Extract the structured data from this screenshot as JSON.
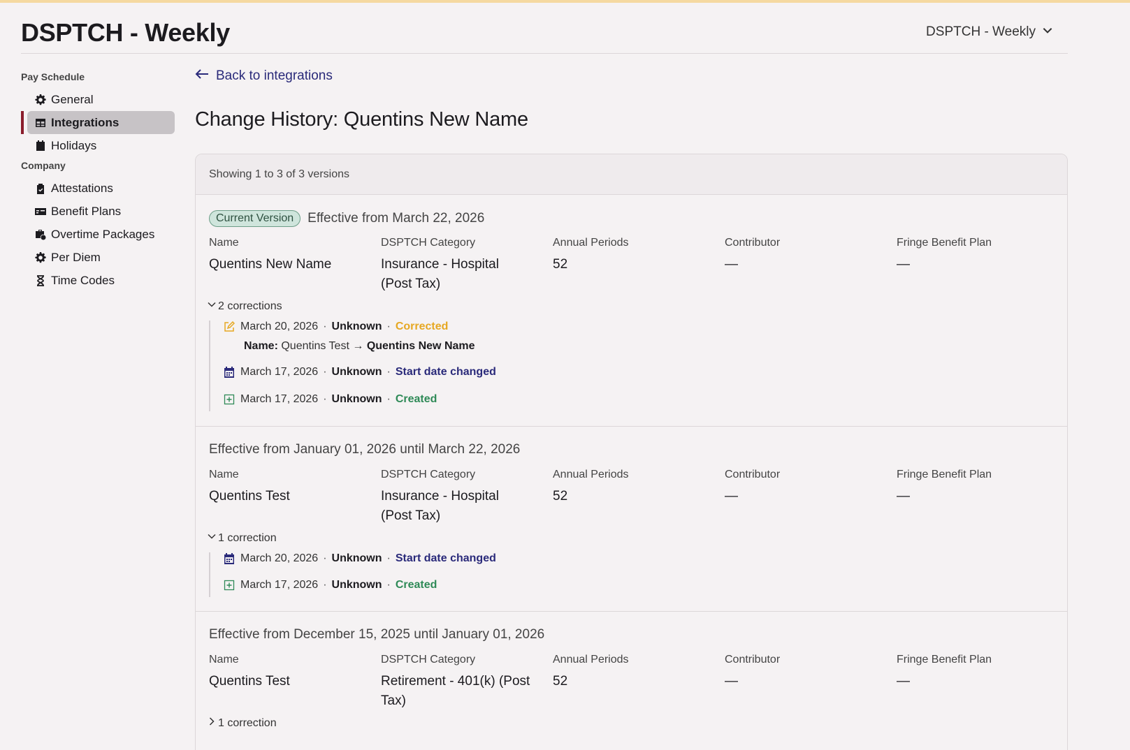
{
  "app": {
    "title": "DSPTCH - Weekly",
    "switcher_label": "DSPTCH - Weekly"
  },
  "sidebar": {
    "sections": [
      {
        "title": "Pay Schedule",
        "items": [
          {
            "label": "General",
            "icon": "gear-icon",
            "active": false
          },
          {
            "label": "Integrations",
            "icon": "table-icon",
            "active": true
          },
          {
            "label": "Holidays",
            "icon": "calendar-icon",
            "active": false
          }
        ]
      },
      {
        "title": "Company",
        "items": [
          {
            "label": "Attestations",
            "icon": "clipboard-check-icon",
            "active": false
          },
          {
            "label": "Benefit Plans",
            "icon": "money-check-icon",
            "active": false
          },
          {
            "label": "Overtime Packages",
            "icon": "briefcase-clock-icon",
            "active": false
          },
          {
            "label": "Per Diem",
            "icon": "gear-icon",
            "active": false
          },
          {
            "label": "Time Codes",
            "icon": "hourglass-icon",
            "active": false
          }
        ]
      }
    ]
  },
  "back_link": "Back to integrations",
  "page_title": "Change History: Quentins New Name",
  "summary": "Showing 1 to 3 of 3 versions",
  "field_labels": {
    "name": "Name",
    "category": "DSPTCH Category",
    "periods": "Annual Periods",
    "contributor": "Contributor",
    "fringe": "Fringe Benefit Plan"
  },
  "versions": [
    {
      "badge": "Current Version",
      "effective": "Effective from March 22, 2026",
      "name": "Quentins New Name",
      "category_line1": "Insurance - Hospital",
      "category_line2": "(Post Tax)",
      "periods": "52",
      "contributor": "—",
      "fringe": "—",
      "corrections_label": "2 corrections",
      "corrections_expanded": true,
      "corrections": [
        {
          "date": "March 20, 2026",
          "by": "Unknown",
          "status": "Corrected",
          "icon": "edit-icon",
          "diff": {
            "field": "Name:",
            "from": "Quentins Test",
            "arrow": "→",
            "to": "Quentins New Name"
          }
        },
        {
          "date": "March 17, 2026",
          "by": "Unknown",
          "status": "Start date changed",
          "icon": "calendar-icon"
        },
        {
          "date": "March 17, 2026",
          "by": "Unknown",
          "status": "Created",
          "icon": "plus-square-icon"
        }
      ]
    },
    {
      "effective": "Effective from January 01, 2026 until March 22, 2026",
      "name": "Quentins Test",
      "category_line1": "Insurance - Hospital",
      "category_line2": "(Post Tax)",
      "periods": "52",
      "contributor": "—",
      "fringe": "—",
      "corrections_label": "1 correction",
      "corrections_expanded": true,
      "corrections": [
        {
          "date": "March 20, 2026",
          "by": "Unknown",
          "status": "Start date changed",
          "icon": "calendar-icon"
        },
        {
          "date": "March 17, 2026",
          "by": "Unknown",
          "status": "Created",
          "icon": "plus-square-icon"
        }
      ]
    },
    {
      "effective": "Effective from December 15, 2025 until January 01, 2026",
      "name": "Quentins Test",
      "category_line1": "Retirement - 401(k) (Post",
      "category_line2": "Tax)",
      "periods": "52",
      "contributor": "—",
      "fringe": "—",
      "corrections_label": "1 correction",
      "corrections_expanded": false
    }
  ],
  "colors": {
    "accent_active": "#8b1d2c",
    "link": "#2a2a7a",
    "corrected": "#e6a823",
    "created": "#2f8a57",
    "badge_bg": "#cfe5dc"
  },
  "separator": "·"
}
